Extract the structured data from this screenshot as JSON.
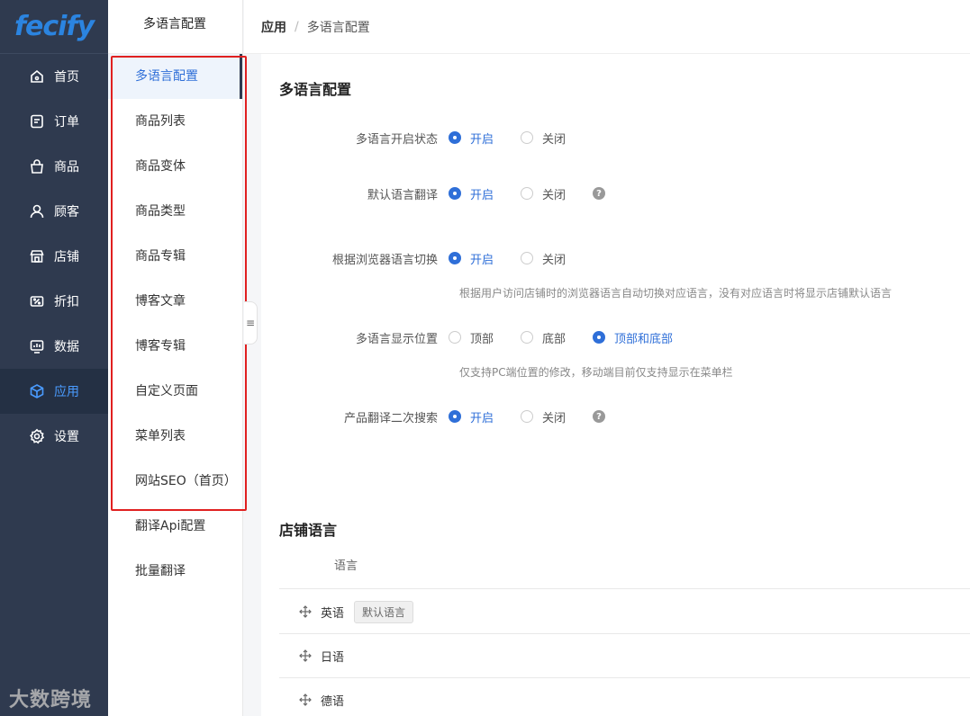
{
  "app": {
    "logo_text": "fecify"
  },
  "nav": [
    {
      "label": "首页",
      "icon": "home-icon"
    },
    {
      "label": "订单",
      "icon": "order-icon"
    },
    {
      "label": "商品",
      "icon": "bag-icon"
    },
    {
      "label": "顾客",
      "icon": "user-icon"
    },
    {
      "label": "店铺",
      "icon": "store-icon"
    },
    {
      "label": "折扣",
      "icon": "discount-icon"
    },
    {
      "label": "数据",
      "icon": "chart-icon"
    },
    {
      "label": "应用",
      "icon": "cube-icon",
      "active": true
    },
    {
      "label": "设置",
      "icon": "gear-icon"
    }
  ],
  "submenu": {
    "title": "多语言配置",
    "items": [
      "多语言配置",
      "商品列表",
      "商品变体",
      "商品类型",
      "商品专辑",
      "博客文章",
      "博客专辑",
      "自定义页面",
      "菜单列表",
      "网站SEO（首页）",
      "翻译Api配置",
      "批量翻译"
    ]
  },
  "breadcrumb": {
    "root": "应用",
    "sep": "/",
    "current": "多语言配置"
  },
  "config": {
    "title": "多语言配置",
    "on": "开启",
    "off": "关闭",
    "rows": {
      "status": "多语言开启状态",
      "default_translate": "默认语言翻译",
      "browser_switch": "根据浏览器语言切换",
      "position": "多语言显示位置",
      "search": "产品翻译二次搜索"
    },
    "browser_hint": "根据用户访问店铺时的浏览器语言自动切换对应语言，没有对应语言时将显示店铺默认语言",
    "position_options": [
      "顶部",
      "底部",
      "顶部和底部"
    ],
    "position_hint": "仅支持PC端位置的修改，移动端目前仅支持显示在菜单栏"
  },
  "store_lang": {
    "title": "店铺语言",
    "column": "语言",
    "rows": [
      "英语",
      "日语",
      "德语"
    ],
    "default_tag": "默认语言"
  },
  "watermark": "大数跨境",
  "colors": {
    "sidebar": "#2f3a4f",
    "accent": "#2f6fd8",
    "highlight": "#e02020"
  }
}
